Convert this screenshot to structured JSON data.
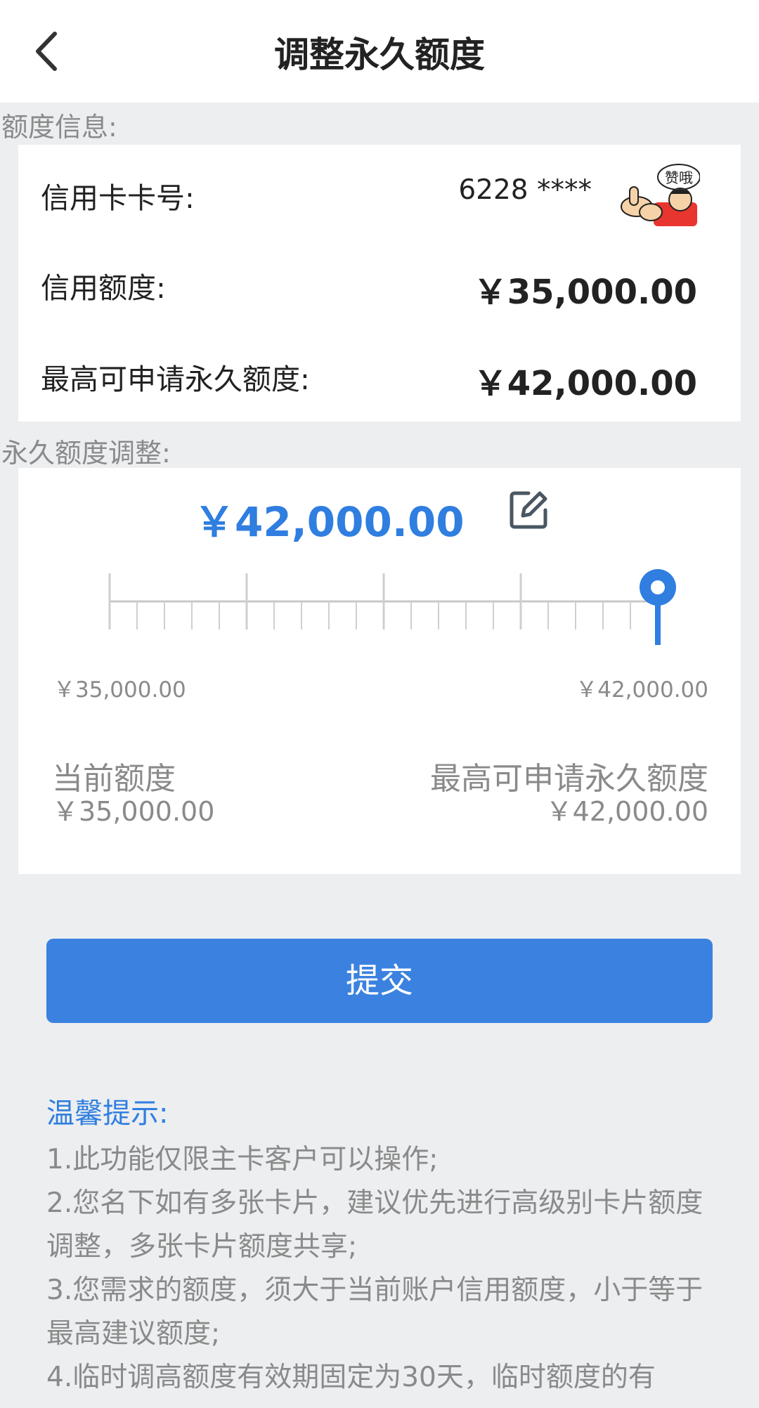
{
  "header": {
    "title": "调整永久额度",
    "back_icon": "chevron-left-icon"
  },
  "info_section": {
    "label": "额度信息:",
    "card_number_label": "信用卡卡号:",
    "card_number_value": "6228 ****",
    "credit_limit_label": "信用额度:",
    "credit_limit_value": "￥35,000.00",
    "max_limit_label": "最高可申请永久额度:",
    "max_limit_value": "￥42,000.00",
    "sticker_text": "赞哦"
  },
  "adjust_section": {
    "label": "永久额度调整:",
    "selected_amount": "￥42,000.00",
    "edit_icon": "edit-icon",
    "slider": {
      "min": 35000,
      "max": 42000,
      "value": 42000
    },
    "min_tick_label": "￥35,000.00",
    "max_tick_label": "￥42,000.00",
    "current_label": "当前额度",
    "current_value": "￥35,000.00",
    "max_label": "最高可申请永久额度",
    "max_value": "￥42,000.00"
  },
  "submit_label": "提交",
  "tips": {
    "title": "温馨提示:",
    "items": [
      "1.此功能仅限主卡客户可以操作;",
      "2.您名下如有多张卡片，建议优先进行高级别卡片额度调整，多张卡片额度共享;",
      "3.您需求的额度，须大于当前账户信用额度，小于等于最高建议额度;",
      "4.临时调高额度有效期固定为30天，临时额度的有"
    ]
  },
  "colors": {
    "accent": "#2f7ee0",
    "button": "#3b82e0",
    "background": "#eceef0"
  }
}
